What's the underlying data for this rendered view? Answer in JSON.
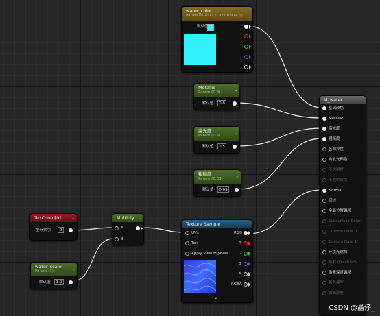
{
  "colors": {
    "param_header": "#3d5c1f",
    "constant_header": "#7a6220",
    "texcoord_header": "#7a1a1a",
    "texture_header": "#1f4f6e",
    "result_header": "#5a5a5a",
    "water_color_swatch": "#33f0ff",
    "normal_preview": "#2860e0"
  },
  "water_color": {
    "title": "water_color",
    "subtitle": "Param (0.2011,0.977,0.974,1)",
    "default_label": "默认值"
  },
  "metallic": {
    "title": "Metallic",
    "subtitle": "Param (0.8)",
    "default_label": "默认值",
    "value": "0.8"
  },
  "specular": {
    "title": "高光度",
    "subtitle": "Param (0.5)",
    "default_label": "默认值",
    "value": "0.5"
  },
  "roughness": {
    "title": "粗糙度",
    "subtitle": "Param (0.03)",
    "default_label": "默认值",
    "value": "0.03"
  },
  "texcoord": {
    "title": "TexCoord[0]",
    "index_label": "坐标索引",
    "index_value": "0"
  },
  "water_scale": {
    "title": "water_scale",
    "subtitle": "Param (1)",
    "default_label": "默认值",
    "value": "1.0"
  },
  "multiply": {
    "title": "Multiply",
    "in_a": "A",
    "in_b": "B"
  },
  "texture_sample": {
    "title": "Texture Sample",
    "uvs": "UVs",
    "tex": "Tex",
    "apply_mip": "Apply View MipBias",
    "out_rgb": "RGB",
    "out_r": "R",
    "out_g": "G",
    "out_b": "B",
    "out_a": "A",
    "out_rgba": "RGBA"
  },
  "result": {
    "title": "M_water",
    "pins": [
      {
        "label": "基础颜色",
        "state": "on"
      },
      {
        "label": "Metallic",
        "state": "on"
      },
      {
        "label": "高光度",
        "state": "on"
      },
      {
        "label": "粗糙度",
        "state": "on"
      },
      {
        "label": "各向异性",
        "state": "off"
      },
      {
        "label": "自发光颜色",
        "state": "off"
      },
      {
        "label": "不透明度",
        "state": "dim"
      },
      {
        "label": "不透明蒙版",
        "state": "dim"
      },
      {
        "label": "Normal",
        "state": "on"
      },
      {
        "label": "切线",
        "state": "off"
      },
      {
        "label": "全局位置偏移",
        "state": "off"
      },
      {
        "label": "Subsurface Color",
        "state": "dim"
      },
      {
        "label": "Custom Data 0",
        "state": "dim"
      },
      {
        "label": "Custom Data 1",
        "state": "dim"
      },
      {
        "label": "环境光遮挡",
        "state": "off"
      },
      {
        "label": "折射 (Disabled)",
        "state": "dim"
      },
      {
        "label": "像素深度偏移",
        "state": "off"
      },
      {
        "label": "着色模型",
        "state": "dim"
      },
      {
        "label": "表面厚度",
        "state": "dim"
      }
    ]
  },
  "watermark": "CSDN @晶仔_"
}
